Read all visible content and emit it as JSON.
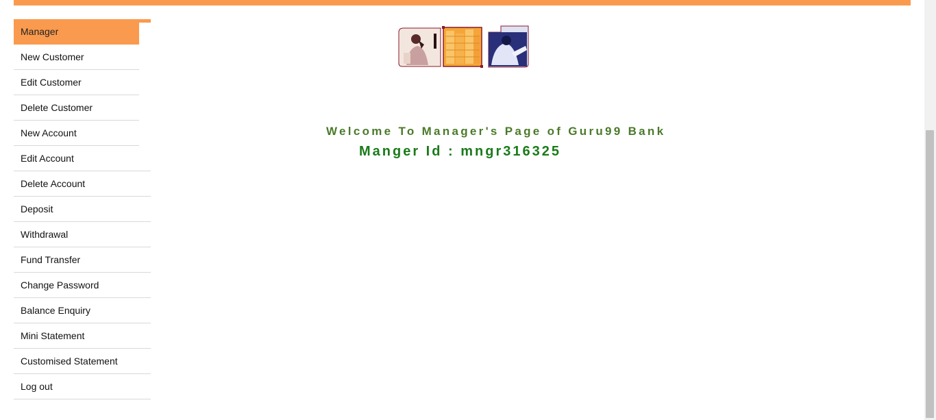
{
  "sidebar": {
    "items": [
      {
        "label": "Manager"
      },
      {
        "label": "New Customer"
      },
      {
        "label": "Edit Customer"
      },
      {
        "label": "Delete Customer"
      },
      {
        "label": "New Account"
      },
      {
        "label": "Edit Account"
      },
      {
        "label": "Delete Account"
      },
      {
        "label": "Deposit"
      },
      {
        "label": "Withdrawal"
      },
      {
        "label": "Fund Transfer"
      },
      {
        "label": "Change Password"
      },
      {
        "label": "Balance Enquiry"
      },
      {
        "label": "Mini Statement"
      },
      {
        "label": "Customised Statement"
      },
      {
        "label": "Log out"
      }
    ]
  },
  "main": {
    "welcome_text": "Welcome To Manager's Page of Guru99 Bank",
    "manager_id_text": "Manger Id : mngr316325"
  },
  "colors": {
    "accent": "#fa9a4e",
    "welcome": "#4a7a2a",
    "manager_id": "#1a7a1a"
  }
}
